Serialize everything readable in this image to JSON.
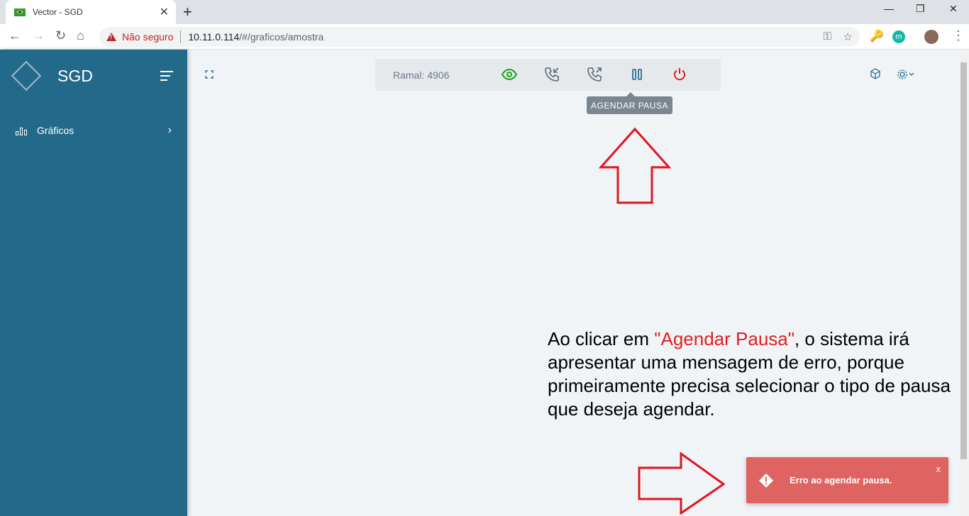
{
  "browser": {
    "tab_title": "Vector - SGD",
    "tab_close": "✕",
    "new_tab": "+",
    "security_label": "Não seguro",
    "url_host": "10.11.0.114",
    "url_path": "/#/graficos/amostra",
    "ext_m_label": "m"
  },
  "sidebar": {
    "brand": "SGD",
    "menu": [
      {
        "label": "Gráficos",
        "icon": "bar-chart-icon"
      }
    ],
    "bg_color": "#236a8a"
  },
  "callbar": {
    "ramal": "Ramal: 4906",
    "icons": [
      "eye-icon",
      "incoming-call-icon",
      "outgoing-call-icon",
      "pause-icon",
      "power-icon"
    ],
    "colors": {
      "eye": "#1aa51a",
      "call": "#5d6a75",
      "pause": "#2a6f93",
      "power": "#e02020"
    }
  },
  "tooltip": {
    "text": "AGENDAR PAUSA"
  },
  "annotation": {
    "part1": "Ao clicar em ",
    "highlight": "\"Agendar Pausa\"",
    "part2": ", o sistema irá apresentar uma mensagem de erro, porque primeiramente precisa selecionar o tipo de pausa que deseja agendar."
  },
  "toast": {
    "message": "Erro ao agendar pausa.",
    "close": "x",
    "bg_color": "#df6360"
  }
}
